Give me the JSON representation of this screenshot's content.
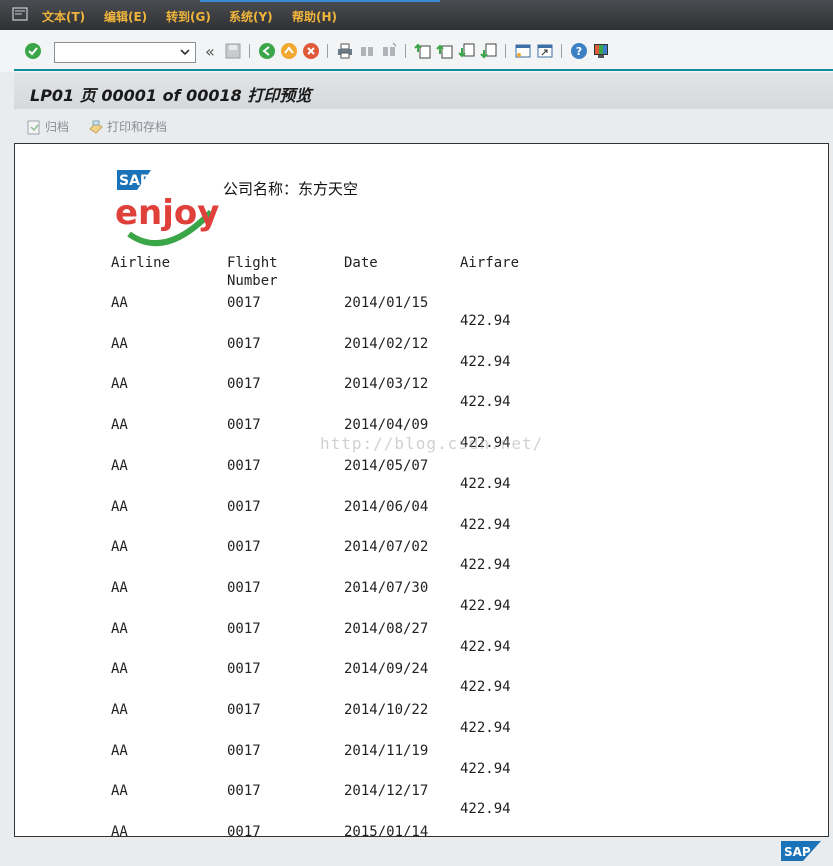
{
  "menu": {
    "items": [
      "文本(T)",
      "编辑(E)",
      "转到(G)",
      "系统(Y)",
      "帮助(H)"
    ]
  },
  "toolbar": {
    "command_value": "",
    "icons": [
      "enter-icon",
      "save-icon",
      "back-icon",
      "exit-icon",
      "cancel-icon",
      "print-icon",
      "find-icon",
      "find-next-icon",
      "first-page-icon",
      "previous-page-icon",
      "next-page-icon",
      "last-page-icon",
      "new-session-icon",
      "shortcut-icon",
      "help-icon",
      "customize-layout-icon"
    ]
  },
  "title": "LP01 页 00001 of 00018 打印预览",
  "app_toolbar": {
    "archive": "归档",
    "print_archive": "打印和存档"
  },
  "document": {
    "company": "公司名称：东方天空",
    "logo_text": {
      "brand": "SAP",
      "word": "enjoy"
    },
    "headers": {
      "airline": "Airline",
      "flight_line1": "Flight",
      "flight_line2": "Number",
      "date": "Date",
      "airfare": "Airfare"
    },
    "rows": [
      {
        "airline": "AA",
        "flight": "0017",
        "date": "2014/01/15",
        "airfare": "422.94"
      },
      {
        "airline": "AA",
        "flight": "0017",
        "date": "2014/02/12",
        "airfare": "422.94"
      },
      {
        "airline": "AA",
        "flight": "0017",
        "date": "2014/03/12",
        "airfare": "422.94"
      },
      {
        "airline": "AA",
        "flight": "0017",
        "date": "2014/04/09",
        "airfare": "422.94"
      },
      {
        "airline": "AA",
        "flight": "0017",
        "date": "2014/05/07",
        "airfare": "422.94"
      },
      {
        "airline": "AA",
        "flight": "0017",
        "date": "2014/06/04",
        "airfare": "422.94"
      },
      {
        "airline": "AA",
        "flight": "0017",
        "date": "2014/07/02",
        "airfare": "422.94"
      },
      {
        "airline": "AA",
        "flight": "0017",
        "date": "2014/07/30",
        "airfare": "422.94"
      },
      {
        "airline": "AA",
        "flight": "0017",
        "date": "2014/08/27",
        "airfare": "422.94"
      },
      {
        "airline": "AA",
        "flight": "0017",
        "date": "2014/09/24",
        "airfare": "422.94"
      },
      {
        "airline": "AA",
        "flight": "0017",
        "date": "2014/10/22",
        "airfare": "422.94"
      },
      {
        "airline": "AA",
        "flight": "0017",
        "date": "2014/11/19",
        "airfare": "422.94"
      },
      {
        "airline": "AA",
        "flight": "0017",
        "date": "2014/12/17",
        "airfare": "422.94"
      },
      {
        "airline": "AA",
        "flight": "0017",
        "date": "2015/01/14",
        "airfare": ""
      }
    ],
    "watermark": "http://blog.csdn.net/"
  },
  "status": {
    "sap_logo": "SAP"
  },
  "colors": {
    "menu_text": "#f0b43c",
    "teal_line": "#0f8ea3",
    "sap_blue": "#1a73b8"
  }
}
